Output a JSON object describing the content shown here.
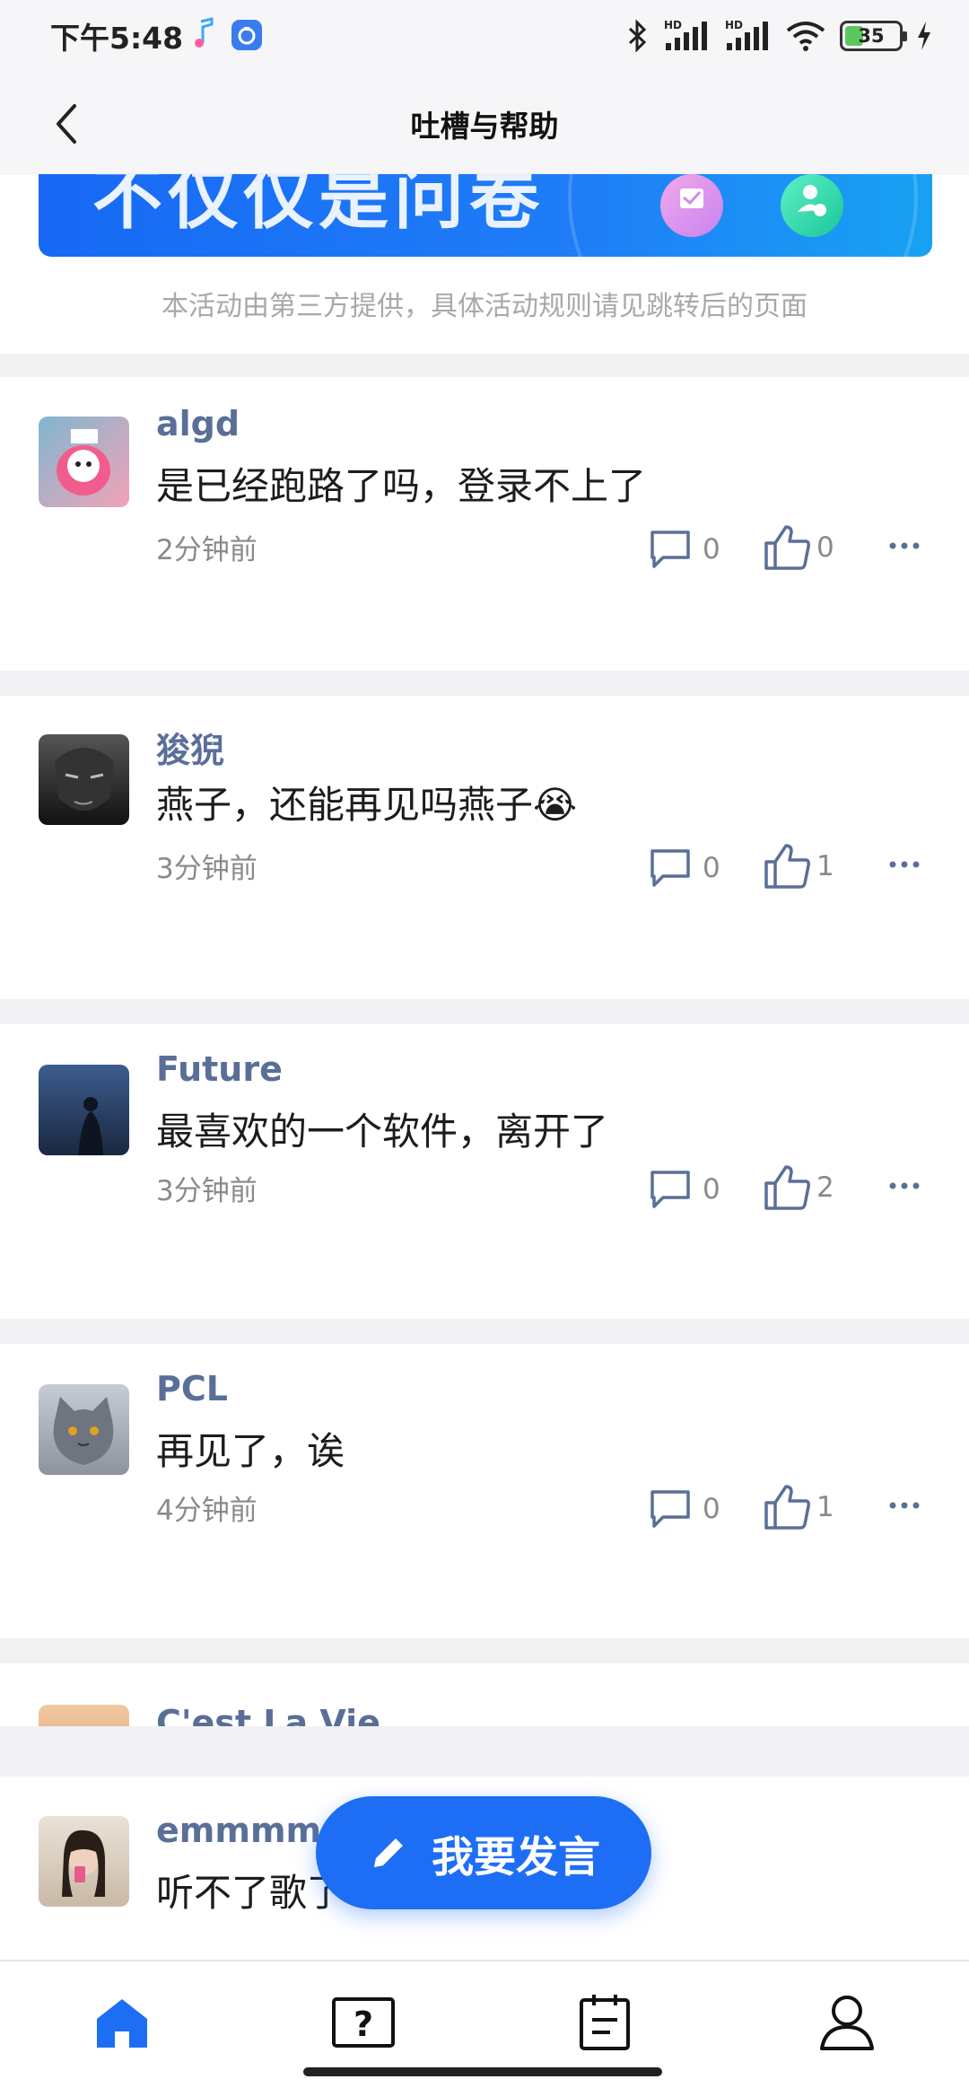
{
  "status_bar": {
    "time": "下午5:48",
    "battery": "35",
    "battery_level": 0.35,
    "icons": [
      "music-note-icon",
      "app-notification-icon",
      "bluetooth-icon",
      "signal-hd-icon",
      "signal-hd-icon",
      "wifi-icon",
      "battery-icon",
      "charging-icon"
    ]
  },
  "header": {
    "title": "吐槽与帮助",
    "back_icon": "chevron-left-icon"
  },
  "banner": {
    "text": "不仅仅是问卷",
    "note": "本活动由第三方提供，具体活动规则请见跳转后的页面"
  },
  "posts": [
    {
      "username": "algd",
      "content": "是已经跑路了吗，登录不上了",
      "time": "2分钟前",
      "comments": "0",
      "likes": "0"
    },
    {
      "username": "狻猊",
      "content": "燕子，还能再见吗燕子",
      "emoji": "😭",
      "time": "3分钟前",
      "comments": "0",
      "likes": "1"
    },
    {
      "username": "Future",
      "content": "最喜欢的一个软件，离开了",
      "time": "3分钟前",
      "comments": "0",
      "likes": "2"
    },
    {
      "username": "PCL",
      "content": "再见了，诶",
      "time": "4分钟前",
      "comments": "0",
      "likes": "1"
    },
    {
      "username": "C'est La Vie"
    },
    {
      "username": "emmmm.",
      "content": "听不了歌了"
    }
  ],
  "fab": {
    "label": "我要发言",
    "icon": "pencil-icon"
  },
  "nav": {
    "items": [
      "home-icon",
      "question-icon",
      "notes-icon",
      "profile-icon"
    ]
  },
  "colors": {
    "accent": "#1d6ef5",
    "username": "#5a6f98",
    "separator": "#f2f2f4"
  }
}
